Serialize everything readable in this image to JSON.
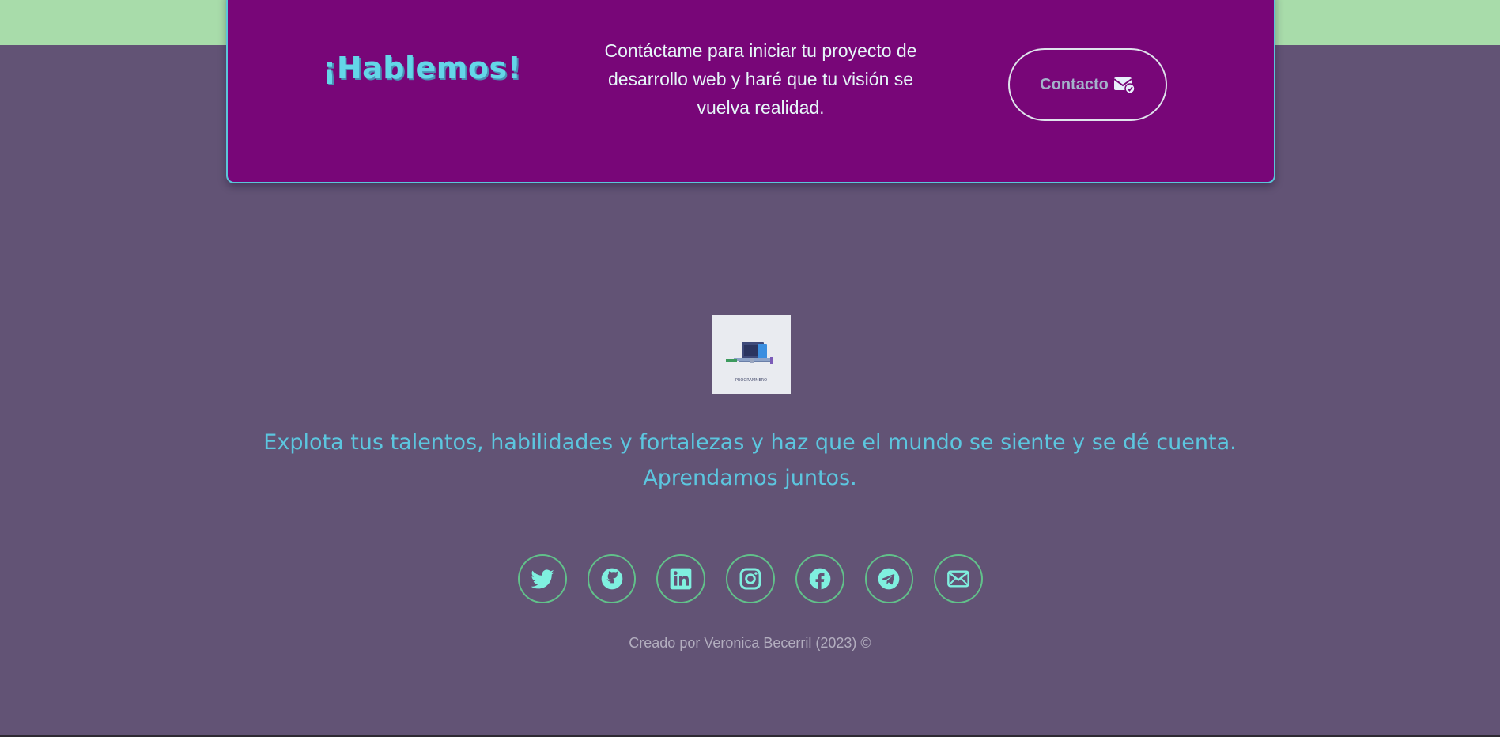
{
  "cta": {
    "title": "¡Hablemos!",
    "text": "Contáctame para iniciar tu proyecto de desarrollo web y haré que tu visión se vuelva realidad.",
    "button_label": "Contacto",
    "button_icon": "envelope-check-icon"
  },
  "logo": {
    "caption": "PROGRAMMERO"
  },
  "tagline": {
    "line1": "Explota tus talentos, habilidades y fortalezas y haz que el mundo se siente y se dé cuenta.",
    "line2": "Aprendamos juntos."
  },
  "socials": [
    {
      "name": "Twitter",
      "icon": "twitter-icon"
    },
    {
      "name": "GitHub",
      "icon": "github-icon"
    },
    {
      "name": "LinkedIn",
      "icon": "linkedin-icon"
    },
    {
      "name": "Instagram",
      "icon": "instagram-icon"
    },
    {
      "name": "Facebook",
      "icon": "facebook-icon"
    },
    {
      "name": "Telegram",
      "icon": "telegram-icon"
    },
    {
      "name": "Email",
      "icon": "mail-icon"
    }
  ],
  "footer": {
    "credits": "Creado por Veronica Becerril (2023) ©"
  },
  "colors": {
    "page_bg": "#625375",
    "top_band": "#a8dcaa",
    "card_bg": "#780678",
    "accent_cyan": "#5cc6df",
    "icon_fill": "#7ff0df",
    "social_border": "#61c18a"
  }
}
